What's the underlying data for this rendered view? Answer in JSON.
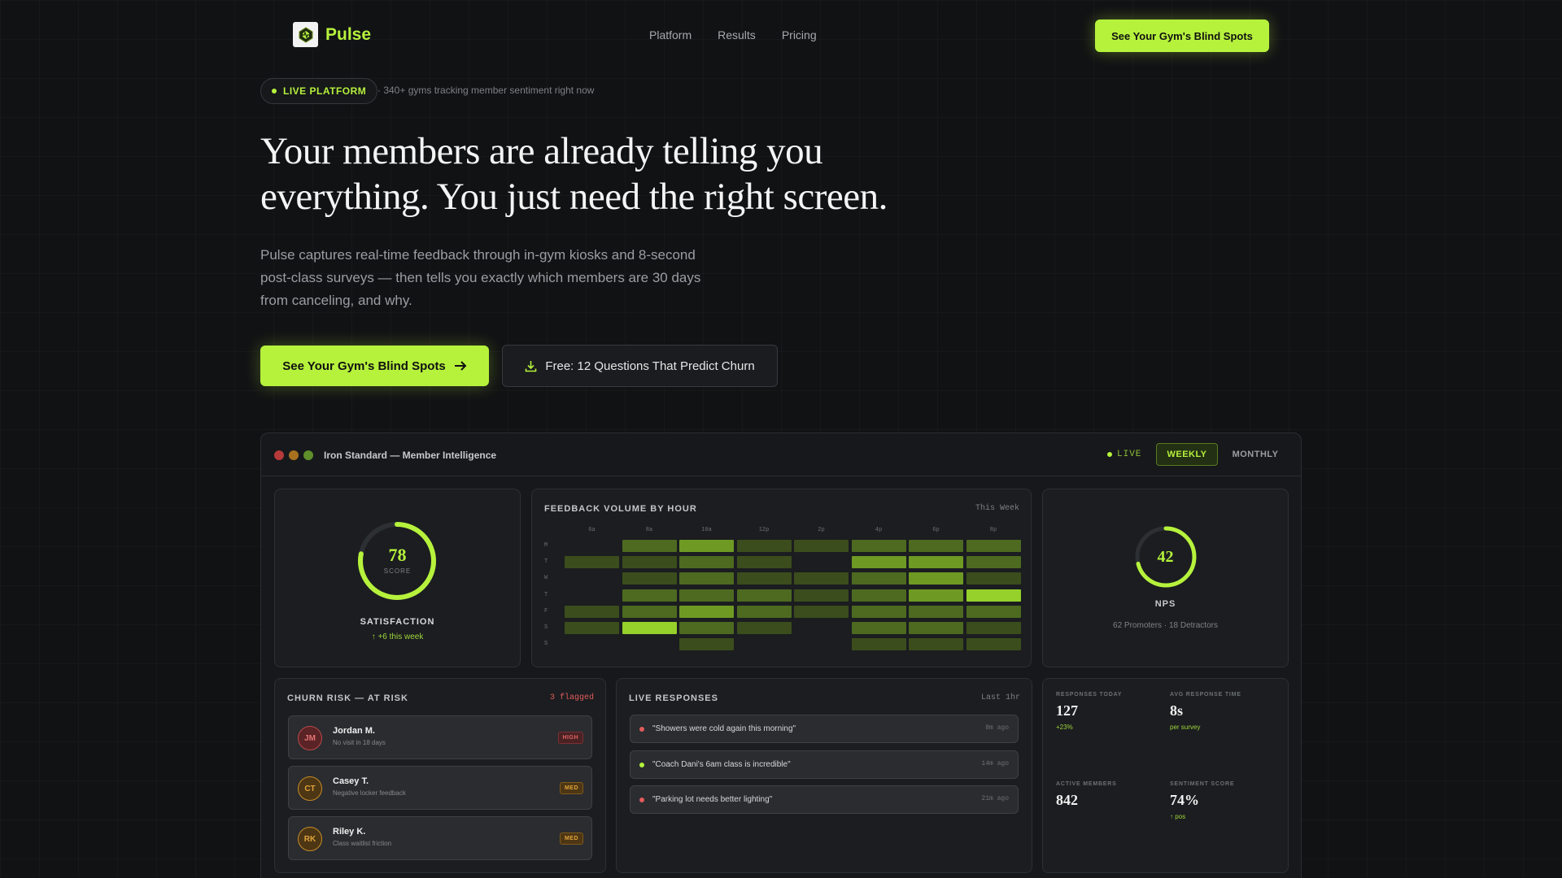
{
  "nav": {
    "brand": "Pulse",
    "links": [
      "Platform",
      "Results",
      "Pricing"
    ],
    "cta": "See Your Gym's Blind Spots"
  },
  "hero": {
    "pill": "LIVE PLATFORM",
    "pill_sub": "· 340+ gyms tracking member sentiment right now",
    "title_line1": "Your members are already telling you",
    "title_line2": "everything. You just need the right screen.",
    "subtitle": "Pulse captures real-time feedback through in-gym kiosks and 8-second post-class surveys — then tells you exactly which members are 30 days from canceling, and why.",
    "primary_cta": "See Your Gym's Blind Spots",
    "secondary_cta": "Free: 12 Questions That Predict Churn"
  },
  "dashboard": {
    "title": "Iron Standard — Member Intelligence",
    "live": "LIVE",
    "tab_weekly": "WEEKLY",
    "tab_monthly": "MONTHLY",
    "satisfaction": {
      "score": "78",
      "score_caption": "SCORE",
      "score_fraction": 0.78,
      "label": "SATISFACTION",
      "delta": "↑ +6 this week"
    },
    "heatmap": {
      "title": "FEEDBACK VOLUME BY HOUR",
      "range": "This Week",
      "columns": [
        "6a",
        "8a",
        "10a",
        "12p",
        "2p",
        "4p",
        "6p",
        "8p"
      ],
      "rows": [
        "M",
        "T",
        "W",
        "T",
        "F",
        "S",
        "S"
      ],
      "levels": [
        [
          0,
          3,
          4,
          2,
          2,
          3,
          3,
          3
        ],
        [
          2,
          2,
          3,
          2,
          0,
          4,
          4,
          3
        ],
        [
          0,
          2,
          3,
          2,
          2,
          3,
          4,
          2
        ],
        [
          0,
          3,
          3,
          3,
          2,
          3,
          4,
          5
        ],
        [
          2,
          3,
          4,
          3,
          2,
          3,
          3,
          3
        ],
        [
          2,
          5,
          3,
          2,
          0,
          3,
          3,
          2
        ],
        [
          0,
          0,
          2,
          0,
          0,
          2,
          2,
          2
        ]
      ]
    },
    "nps": {
      "value": "42",
      "fraction": 0.71,
      "label": "NPS",
      "sub": "62 Promoters · 18 Detractors"
    },
    "churn": {
      "title": "CHURN RISK — AT RISK",
      "flagged": "3 flagged",
      "members": [
        {
          "initials": "JM",
          "name": "Jordan M.",
          "reason": "No visit in 18 days",
          "level": "HIGH"
        },
        {
          "initials": "CT",
          "name": "Casey T.",
          "reason": "Negative locker feedback",
          "level": "MED"
        },
        {
          "initials": "RK",
          "name": "Riley K.",
          "reason": "Class waitlist friction",
          "level": "MED"
        }
      ]
    },
    "responses": {
      "title": "LIVE RESPONSES",
      "window": "Last 1hr",
      "items": [
        {
          "text": "\"Showers were cold again this morning\"",
          "ago": "8m ago",
          "sentiment": "negative"
        },
        {
          "text": "\"Coach Dani's 6am class is incredible\"",
          "ago": "14m ago",
          "sentiment": "positive"
        },
        {
          "text": "\"Parking lot needs better lighting\"",
          "ago": "21m ago",
          "sentiment": "negative"
        }
      ]
    },
    "stats": [
      {
        "label": "RESPONSES TODAY",
        "value": "127",
        "sub": "+23%"
      },
      {
        "label": "AVG RESPONSE TIME",
        "value": "8s",
        "sub": "per survey"
      },
      {
        "label": "ACTIVE MEMBERS",
        "value": "842",
        "sub": ""
      },
      {
        "label": "SENTIMENT SCORE",
        "value": "74%",
        "sub": "↑ pos"
      }
    ]
  },
  "colors": {
    "accent": "#b6f23c",
    "negative": "#e25b5b",
    "medium": "#d99a2b",
    "background": "#111214"
  }
}
